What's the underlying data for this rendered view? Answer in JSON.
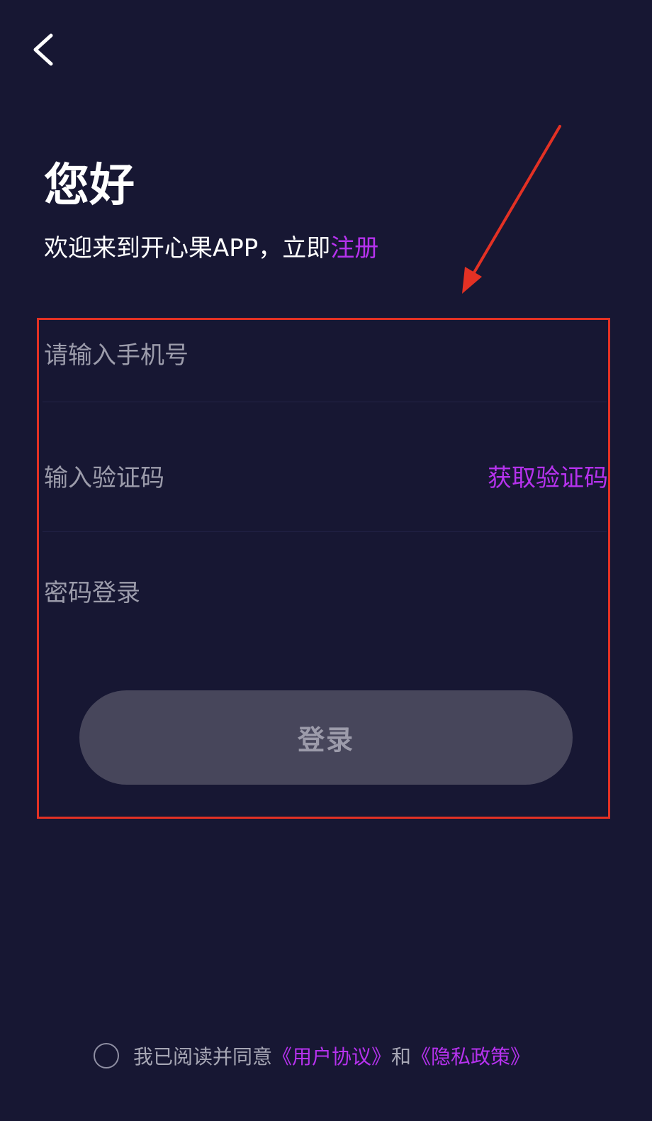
{
  "header": {
    "back_icon": "chevron-left-icon"
  },
  "greeting": {
    "title": "您好",
    "welcome_text": "欢迎来到开心果APP，立即",
    "register_link": "注册"
  },
  "form": {
    "phone_placeholder": "请输入手机号",
    "phone_value": "",
    "code_placeholder": "输入验证码",
    "code_value": "",
    "get_code_label": "获取验证码",
    "password_login_label": "密码登录",
    "login_button_label": "登录"
  },
  "agreement": {
    "prefix": "我已阅读并同意",
    "user_agreement": "《用户协议》",
    "and": "和",
    "privacy_policy": "《隐私政策》",
    "checked": false
  },
  "colors": {
    "background": "#171733",
    "accent": "#b632ee",
    "annotation": "#e33124",
    "button_bg": "#47465b"
  }
}
